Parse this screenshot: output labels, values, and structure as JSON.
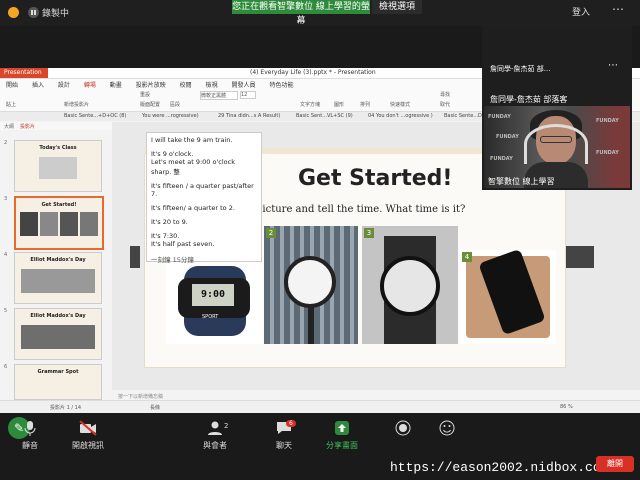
{
  "zoom": {
    "recording_label": "錄製中",
    "share_banner": "您正在觀看智擎數位 線上學習的螢幕",
    "view_options": "檢視選項",
    "login_label": "登入",
    "more_label": "⋯"
  },
  "app": {
    "badge": "Presentation",
    "doc_title": "(4) Everyday Life (3).pptx * - Presentation",
    "menu": [
      "開始",
      "插入",
      "設計",
      "轉場",
      "動畫",
      "投影片放映",
      "校閱",
      "檢視",
      "開發人員",
      "特色功能"
    ],
    "ribbon": {
      "paste": "貼上",
      "new_slide": "新增投影片",
      "reset": "重設",
      "layout": "版面配置",
      "section": "區段",
      "font": "微軟正黑體",
      "font_size": "12",
      "textbox": "文字方塊",
      "shapes": "圖形",
      "arrange": "排列",
      "quick_style": "快速樣式",
      "find": "尋找",
      "replace": "取代"
    },
    "doc_tabs": [
      "Basic Sente...+D+OC (8)",
      "You were ...rogressive)",
      "29 Tina didn...s A Result)",
      "Basic Sent...VL+SC (9)",
      "04 You don't ...ogressive )",
      "Basic Sente...DO+OC (8)"
    ],
    "sidebar_tabs": [
      "大綱",
      "投影片"
    ],
    "thumbs": [
      {
        "num": "2",
        "title": "Today's Class"
      },
      {
        "num": "3",
        "title": "Get Started!"
      },
      {
        "num": "4",
        "title": "Elliot Maddox's Day"
      },
      {
        "num": "5",
        "title": "Elliot Maddox's Day"
      },
      {
        "num": "6",
        "title": "Grammar Spot"
      }
    ],
    "notes_hint": "按一下以新增備忘稿",
    "status_left": "投影片 1 / 14",
    "status_center": "長條",
    "zoom_level": "86 %"
  },
  "slide": {
    "title": "Get Started!",
    "instruction": "picture and tell the time. What time is it?",
    "badges": [
      "2",
      "3",
      "4"
    ],
    "watch_label": "SPORT",
    "watch_time": "9:00"
  },
  "notes": {
    "lines": [
      "I will take the 9 am train.",
      "It's 9 o'clock.",
      "Let's meet at 9:00 o'clock sharp. 整",
      "It's fifteen / a quarter past/after 7.",
      "It's fifteen/ a quarter to 2.",
      "It's 20 to 9.",
      "It's 7:30.",
      "It's half past seven.",
      "一刻鐘 15分鐘"
    ]
  },
  "video": {
    "name_top": "詹同學-詹杰茹 部...",
    "more": "⋯",
    "name_label": "詹同學-詹杰茹 部落客",
    "caption": "智擎數位 線上學習",
    "wall_text": [
      "FUNDAY",
      "FUNDAY",
      "FUNDAY",
      "FUNDAY",
      "FUNDAY"
    ]
  },
  "toolbar": {
    "mute": "靜音",
    "video_off": "開啟視訊",
    "participants": "與會者",
    "participants_count": "2",
    "chat": "聊天",
    "chat_badge": "6",
    "share": "分享畫面",
    "record": "錄製",
    "reactions": "反應",
    "end": "離開",
    "watermark": "https://eason2002.nidbox.com"
  },
  "colors": {
    "accent_green": "#2e8b3c",
    "end_red": "#d93025",
    "slide_badge_green": "#6a8d3a",
    "thumb_selected": "#e66a2c"
  }
}
